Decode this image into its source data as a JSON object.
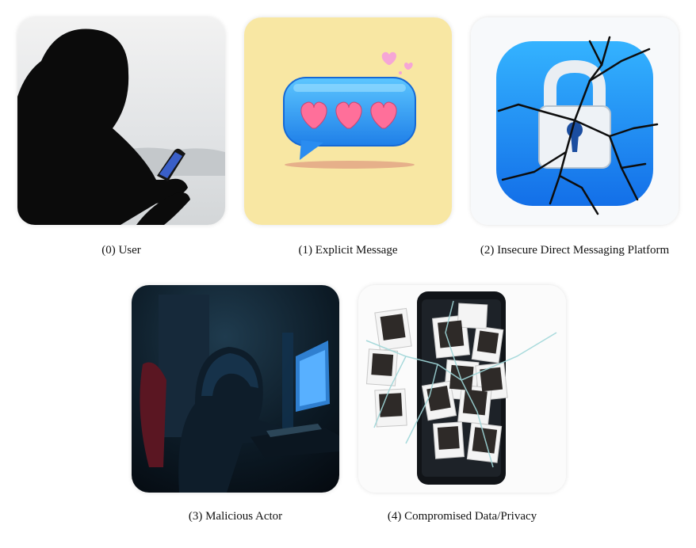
{
  "panels": [
    {
      "label": "(0) User",
      "icon": "hooded-person-phone-icon"
    },
    {
      "label": "(1) Explicit Message",
      "icon": "heart-message-bubble-icon"
    },
    {
      "label": "(2) Insecure Direct Messaging Platform",
      "icon": "cracked-lock-icon"
    },
    {
      "label": "(3) Malicious Actor",
      "icon": "hacker-at-computer-icon"
    },
    {
      "label": "(4) Compromised Data/Privacy",
      "icon": "shattered-phone-photos-icon"
    }
  ]
}
